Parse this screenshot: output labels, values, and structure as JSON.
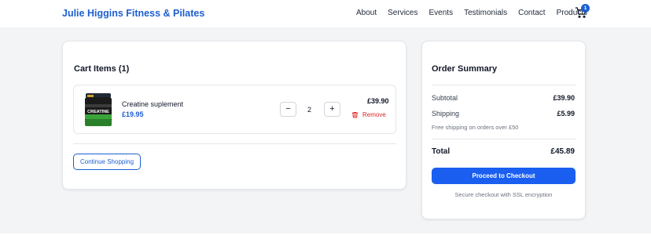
{
  "brand": "Julie Higgins Fitness & Pilates",
  "nav": [
    "About",
    "Services",
    "Events",
    "Testimonials",
    "Contact",
    "Products"
  ],
  "cart_count": "1",
  "cart": {
    "title": "Cart Items (1)",
    "items": [
      {
        "name": "Creatine suplement",
        "unit_price": "£19.95",
        "quantity": "2",
        "line_total": "£39.90",
        "remove_label": "Remove",
        "decrement_label": "−",
        "increment_label": "+",
        "image_label": "CREATINE"
      }
    ],
    "continue_label": "Continue Shopping"
  },
  "summary": {
    "title": "Order Summary",
    "subtotal_label": "Subtotal",
    "subtotal_value": "£39.90",
    "shipping_label": "Shipping",
    "shipping_value": "£5.99",
    "shipping_note": "Free shipping on orders over £50",
    "total_label": "Total",
    "total_value": "£45.89",
    "checkout_label": "Proceed to Checkout",
    "secure_note": "Secure checkout with SSL encryption"
  },
  "colors": {
    "accent": "#1d5fd1",
    "checkout": "#1a5ff0",
    "danger": "#dc2626",
    "background": "#f3f4f6"
  },
  "icons": {
    "cart": "shopping-cart-icon",
    "remove": "trash-icon"
  }
}
